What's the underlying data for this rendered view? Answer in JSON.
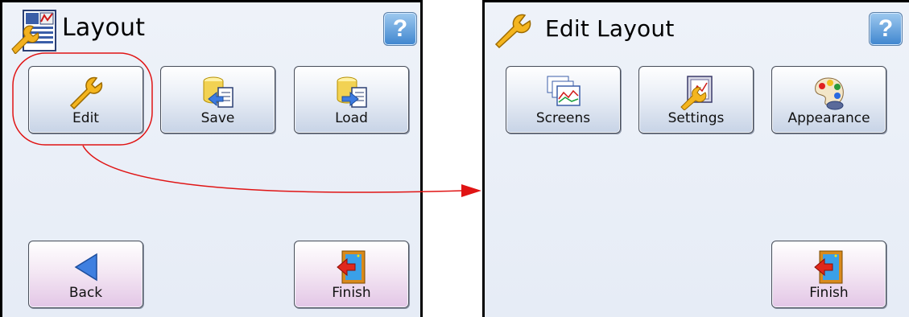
{
  "left": {
    "title": "Layout",
    "help": "?",
    "buttons": {
      "edit": "Edit",
      "save": "Save",
      "load": "Load",
      "back": "Back",
      "finish": "Finish"
    }
  },
  "right": {
    "title": "Edit Layout",
    "help": "?",
    "buttons": {
      "screens": "Screens",
      "settings": "Settings",
      "appearance": "Appearance",
      "finish": "Finish"
    }
  },
  "colors": {
    "annotation": "#e01414",
    "help_button": "#3f86cf",
    "panel_bg": "#e8eef8"
  },
  "icons": [
    "layout-icon",
    "help-icon",
    "wrench-icon",
    "save-icon",
    "load-icon",
    "back-arrow-icon",
    "finish-door-icon",
    "screens-icon",
    "settings-icon",
    "appearance-icon"
  ]
}
